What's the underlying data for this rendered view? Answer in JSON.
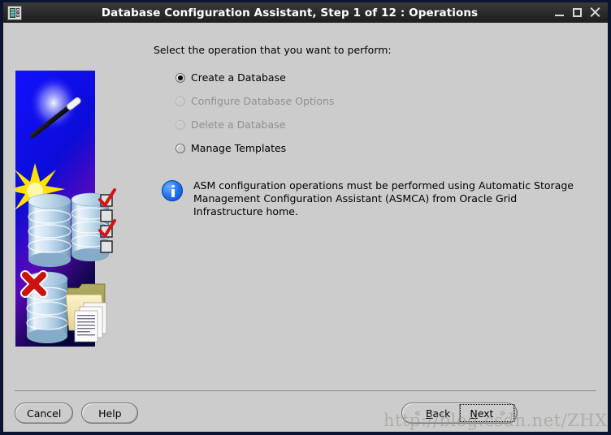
{
  "window": {
    "title": "Database Configuration Assistant, Step 1 of 12 : Operations",
    "icon": "database-wizard-icon",
    "controls": {
      "minimize": "–",
      "maximize": "□",
      "close": "✕"
    }
  },
  "banner": {
    "name": "dbca-illustration",
    "elements": [
      "magic-wand",
      "yellow-starburst",
      "database-cylinder",
      "database-cylinder-with-checklist",
      "red-checkmarks",
      "database-cylinder-with-red-x",
      "folders-with-documents"
    ]
  },
  "main": {
    "prompt": "Select the operation that you want to perform:",
    "options": [
      {
        "label": "Create a Database",
        "selected": true,
        "enabled": true
      },
      {
        "label": "Configure Database Options",
        "selected": false,
        "enabled": false
      },
      {
        "label": "Delete a Database",
        "selected": false,
        "enabled": false
      },
      {
        "label": "Manage Templates",
        "selected": false,
        "enabled": true
      }
    ],
    "info": {
      "icon": "info-icon",
      "line1": "ASM configuration operations must be performed using Automatic Storage",
      "line2": "Management Configuration Assistant (ASMCA) from Oracle Grid Infrastructure home."
    }
  },
  "footer": {
    "cancel_label": "Cancel",
    "help_label": "Help",
    "back": {
      "mnemonic": "B",
      "rest": "ack",
      "chevron": "«",
      "enabled": false
    },
    "next": {
      "mnemonic": "N",
      "rest": "ext",
      "chevron": "»",
      "focused": true
    }
  },
  "watermark": "http://blog.csdn.net/ZHXGXN",
  "colors": {
    "window_bg": "#cccccc",
    "frame": "#0b1430",
    "titlebar": "#2c2c2c",
    "title_text": "#ffffff",
    "disabled_text": "#8f8f8f",
    "info_blue": "#1a6ff0",
    "banner_blue": "#0a0aee",
    "accent_red": "#cc1111",
    "accent_yellow": "#ffe94d"
  }
}
